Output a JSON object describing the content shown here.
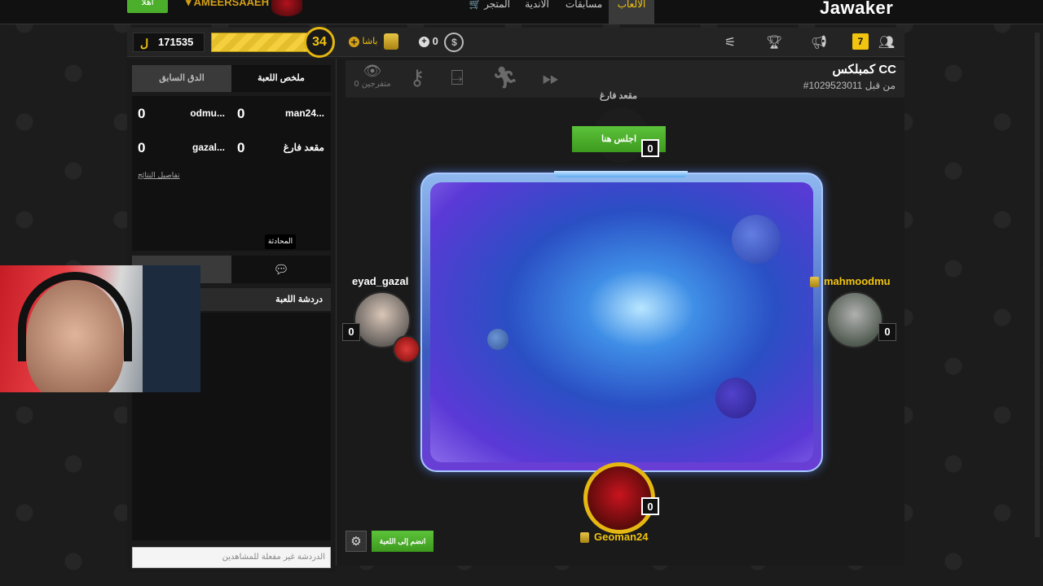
{
  "topnav": {
    "logo": "Jawaker",
    "tabs": [
      {
        "label": "الألعاب",
        "active": true
      },
      {
        "label": "مسابقات"
      },
      {
        "label": "الأندية"
      },
      {
        "label": "المتجر"
      }
    ],
    "username": "AMEERSAAEH",
    "mini_button": "أهلا"
  },
  "statbar": {
    "coins": "171535",
    "level": "34",
    "basha_label": "باشا",
    "gems": "0",
    "notification_count": "7"
  },
  "left_panel": {
    "tabs": [
      {
        "label": "ملخص اللعبة",
        "active": true
      },
      {
        "label": "الدق السابق"
      }
    ],
    "scores": [
      {
        "name": "man24...",
        "score": "0"
      },
      {
        "name": "odmu...",
        "score": "0"
      },
      {
        "name": "مقعد فارغ",
        "score": "0"
      },
      {
        "name": "gazal...",
        "score": "0"
      }
    ],
    "details_link": "تفاصيل النتائج",
    "tooltip": "المحادثة",
    "chat_header": "دردشة اللعبة",
    "chat_placeholder": "الدردشة غير مفعلة للمشاهدين"
  },
  "game": {
    "title": "كمبلكس CC",
    "subtitle": "#1029523011 من قبل",
    "spectators": "0 متفرجين",
    "empty_seat_label": "مقعد فارغ",
    "sit_button": "اجلس هنا",
    "join_button": "انضم إلى اللعبة",
    "players": {
      "top": {
        "score": "0"
      },
      "left": {
        "name": "eyad_gazal",
        "score": "0"
      },
      "right": {
        "name": "mahmoodmu",
        "score": "0"
      },
      "bottom": {
        "name": "Geoman24",
        "score": "0"
      }
    }
  },
  "colors": {
    "accent_gold": "#f1c40f",
    "button_green": "#4caf2c"
  }
}
